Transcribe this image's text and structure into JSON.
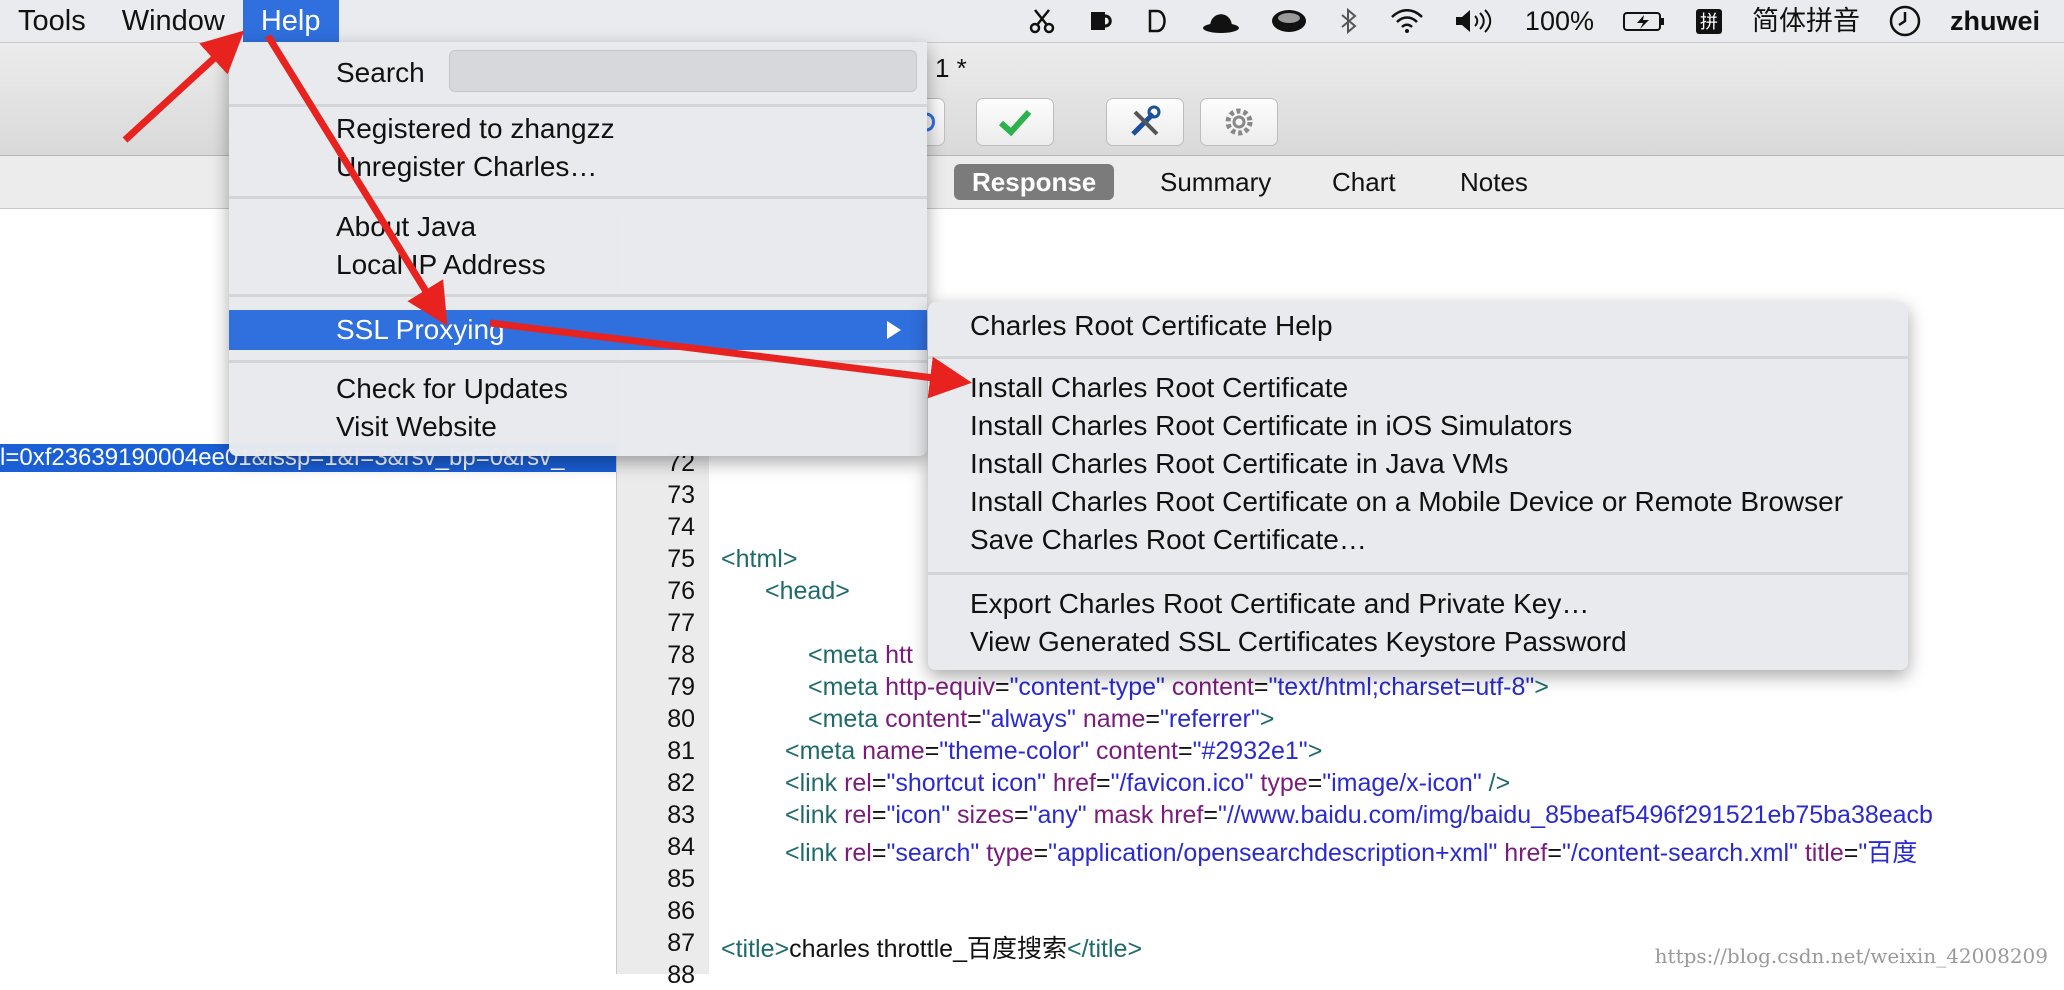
{
  "menubar": {
    "items": [
      "Tools",
      "Window",
      "Help"
    ],
    "status": {
      "battery": "100%",
      "input_method": "简体拼音",
      "user": "zhuwei"
    },
    "icons": [
      "scissors-icon",
      "mug-icon",
      "d-icon",
      "hat-icon",
      "coffee-icon",
      "bluetooth-icon",
      "wifi-icon",
      "volume-icon",
      "battery-icon",
      "pinyin-icon",
      "clock-icon"
    ]
  },
  "window": {
    "title": "1 *"
  },
  "tabs": [
    "Response",
    "Summary",
    "Chart",
    "Notes"
  ],
  "left_pane": {
    "selected_url": "l=0xf23639190004ee01&issp=1&f=3&rsv_bp=0&rsv_"
  },
  "help_menu": {
    "search_label": "Search",
    "registered": "Registered to zhangzz",
    "unregister": "Unregister Charles…",
    "about_java": "About Java",
    "local_ip": "Local IP Address",
    "ssl_proxying": "SSL Proxying",
    "check_updates": "Check for Updates",
    "visit_website": "Visit Website"
  },
  "ssl_submenu": {
    "help": "Charles Root Certificate Help",
    "install": "Install Charles Root Certificate",
    "install_ios": "Install Charles Root Certificate in iOS Simulators",
    "install_java": "Install Charles Root Certificate in Java VMs",
    "install_mobile": "Install Charles Root Certificate on a Mobile Device or Remote Browser",
    "save": "Save Charles Root Certificate…",
    "export": "Export Charles Root Certificate and Private Key…",
    "view_keystore": "View Generated SSL Certificates Keystore Password"
  },
  "code_lines": {
    "numbers": [
      "72",
      "73",
      "74",
      "75",
      "76",
      "77",
      "78",
      "79",
      "80",
      "81",
      "82",
      "83",
      "84",
      "85",
      "86",
      "87",
      "88"
    ],
    "l75": [
      "<",
      "html",
      ">"
    ],
    "l76": [
      "<",
      "head",
      ">"
    ],
    "l78": [
      "<",
      "meta",
      " htt"
    ],
    "l79": [
      "<",
      "meta",
      " http-equiv",
      "=",
      "\"content-type\"",
      " content",
      "=",
      "\"text/html;charset=utf-8\"",
      ">"
    ],
    "l80": [
      "<",
      "meta",
      " content",
      "=",
      "\"always\"",
      " name",
      "=",
      "\"referrer\"",
      ">"
    ],
    "l81": [
      "<",
      "meta",
      " name",
      "=",
      "\"theme-color\"",
      " content",
      "=",
      "\"#2932e1\"",
      ">"
    ],
    "l82": [
      "<",
      "link",
      " rel",
      "=",
      "\"shortcut icon\"",
      " href",
      "=",
      "\"/favicon.ico\"",
      " type",
      "=",
      "\"image/x-icon\"",
      " />"
    ],
    "l83": [
      "<",
      "link",
      " rel",
      "=",
      "\"icon\"",
      " sizes",
      "=",
      "\"any\"",
      " mask href",
      "=",
      "\"//www.baidu.com/img/baidu_85beaf5496f291521eb75ba38eacb"
    ],
    "l84": [
      "<",
      "link",
      " rel",
      "=",
      "\"search\"",
      " type",
      "=",
      "\"application/opensearchdescription+xml\"",
      " href",
      "=",
      "\"/content-search.xml\"",
      " title",
      "=",
      "\"百度"
    ],
    "l87": [
      "<",
      "title",
      ">",
      "charles throttle_百度搜索",
      "</",
      "title",
      ">"
    ]
  },
  "watermark": "https://blog.csdn.net/weixin_42008209",
  "colors": {
    "selection": "#2f6fde",
    "arrow": "#e8231f"
  }
}
